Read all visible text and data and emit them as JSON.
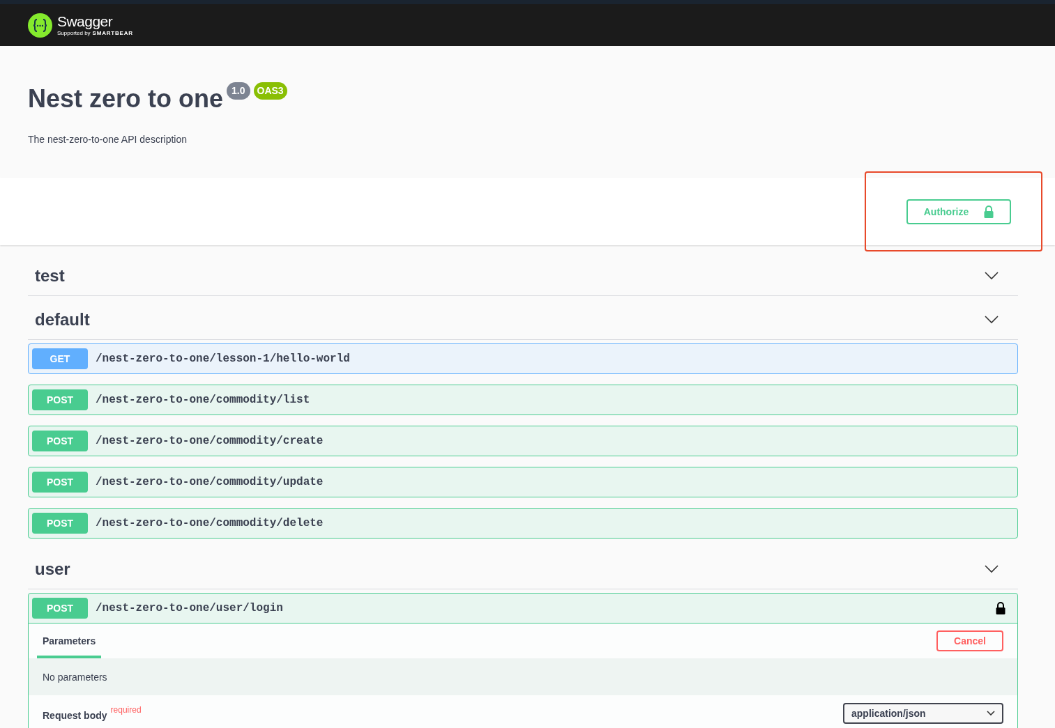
{
  "header": {
    "logo_text": "Swagger",
    "logo_sub": "Supported by",
    "logo_brand": "SMARTBEAR"
  },
  "info": {
    "title": "Nest zero to one",
    "version": "1.0",
    "spec": "OAS3",
    "description": "The nest-zero-to-one API description"
  },
  "authorize": {
    "label": "Authorize",
    "highlighted": true
  },
  "tags": [
    {
      "name": "test",
      "expanded": true
    },
    {
      "name": "default",
      "expanded": true,
      "operations": [
        {
          "method": "GET",
          "path": "/nest-zero-to-one/lesson-1/hello-world",
          "expanded": false,
          "locked": false
        },
        {
          "method": "POST",
          "path": "/nest-zero-to-one/commodity/list",
          "expanded": false,
          "locked": false
        },
        {
          "method": "POST",
          "path": "/nest-zero-to-one/commodity/create",
          "expanded": false,
          "locked": false
        },
        {
          "method": "POST",
          "path": "/nest-zero-to-one/commodity/update",
          "expanded": false,
          "locked": false
        },
        {
          "method": "POST",
          "path": "/nest-zero-to-one/commodity/delete",
          "expanded": false,
          "locked": false
        }
      ]
    },
    {
      "name": "user",
      "expanded": true,
      "operations": [
        {
          "method": "POST",
          "path": "/nest-zero-to-one/user/login",
          "expanded": true,
          "locked": true,
          "details": {
            "tabs": [
              {
                "label": "Parameters",
                "selected": true
              }
            ],
            "cancel": "Cancel",
            "no_params": "No parameters",
            "request_body": "Request body",
            "required": "required",
            "content_type": "application/json"
          }
        }
      ]
    }
  ]
}
